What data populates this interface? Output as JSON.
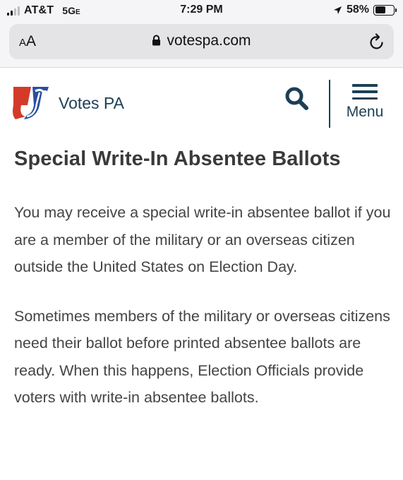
{
  "status_bar": {
    "carrier": "AT&T",
    "network": "5G",
    "network_suffix": "E",
    "time": "7:29 PM",
    "battery_percent": "58%",
    "battery_level": 0.58
  },
  "browser": {
    "text_size_label": "AA",
    "url": "votespa.com"
  },
  "site": {
    "name": "Votes PA",
    "menu_label": "Menu",
    "brand_colors": {
      "navy": "#1c3f55",
      "red": "#d43a2a",
      "blue": "#2a4fa0"
    }
  },
  "article": {
    "title": "Special Write-In Absentee Ballots",
    "paragraphs": [
      "You may receive a special write-in absentee ballot if you are a member of the military or an overseas citizen outside the United States on Election Day.",
      "Sometimes members of the military or overseas citizens need their ballot before printed absentee ballots are ready. When this happens, Election Officials provide voters with write-in absentee ballots."
    ]
  },
  "icons": [
    "signal-icon",
    "location-arrow-icon",
    "battery-icon",
    "lock-icon",
    "reload-icon",
    "votes-pa-logo",
    "search-icon",
    "hamburger-menu-icon"
  ]
}
